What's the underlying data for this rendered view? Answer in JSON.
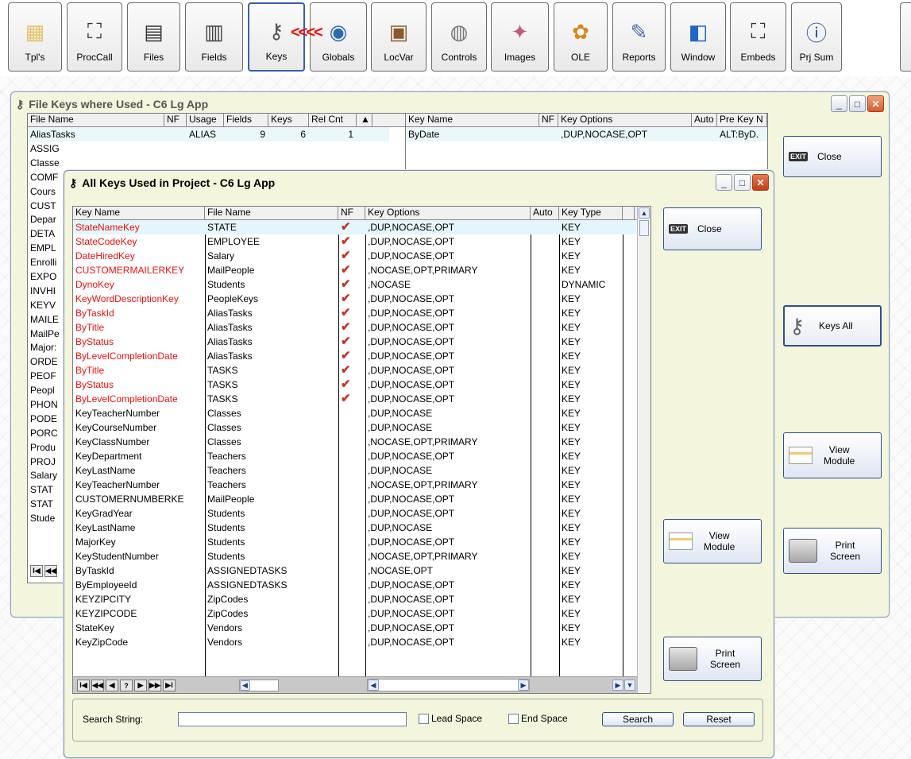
{
  "toolbar": {
    "buttons": [
      {
        "label": "Tpl's"
      },
      {
        "label": "ProcCall"
      },
      {
        "label": "Files"
      },
      {
        "label": "Fields"
      },
      {
        "label": "Keys"
      },
      {
        "label": "Globals"
      },
      {
        "label": "LocVar"
      },
      {
        "label": "Controls"
      },
      {
        "label": "Images"
      },
      {
        "label": "OLE"
      },
      {
        "label": "Reports"
      },
      {
        "label": "Window"
      },
      {
        "label": "Embeds"
      },
      {
        "label": "Prj Sum"
      }
    ],
    "red_arrows": "<<<<"
  },
  "file_keys_window": {
    "title": "File Keys where Used  -  C6 Lg App",
    "files_columns": [
      "File Name",
      "NF",
      "Usage",
      "Fields",
      "Keys",
      "Rel Cnt"
    ],
    "files_first_row": {
      "name": "AliasTasks",
      "usage": "ALIAS",
      "fields": "9",
      "keys": "6",
      "relcnt": "1"
    },
    "files_names": [
      "ASSIG",
      "Classe",
      "COMF",
      "Cours",
      "CUST",
      "Depar",
      "DETA",
      "EMPL",
      "Enrolli",
      "EXPO",
      "INVHI",
      "KEYV",
      "MAILE",
      "MailPe",
      "Major:",
      "ORDE",
      "PEOF",
      "Peopl",
      "PHON",
      "PODE",
      "PORC",
      "Produ",
      "PROJ",
      "Salary",
      "STAT",
      "STAT",
      "Stude"
    ],
    "keys_columns": [
      "Key Name",
      "NF",
      "Key Options",
      "Auto",
      "Pre Key N"
    ],
    "keys_first_row": {
      "name": "ByDate",
      "options": ",DUP,NOCASE,OPT",
      "prekey": "ALT:ByD."
    },
    "close_label": "Close",
    "keys_all_label": "Keys All",
    "keys_all_arrows": ">>>",
    "view_module_label": [
      "View",
      "Module"
    ],
    "print_screen_label": [
      "Print",
      "Screen"
    ],
    "exit_badge": "EXIT"
  },
  "all_keys_window": {
    "title": "All Keys Used in Project  -  C6 Lg App",
    "columns": [
      "Key Name",
      "File Name",
      "NF",
      "Key Options",
      "Auto",
      "Key Type"
    ],
    "rows": [
      {
        "key": "StateNameKey",
        "file": "STATE",
        "nf": true,
        "options": ",DUP,NOCASE,OPT",
        "type": "KEY",
        "red": true
      },
      {
        "key": "StateCodeKey",
        "file": "EMPLOYEE",
        "nf": true,
        "options": ",DUP,NOCASE,OPT",
        "type": "KEY",
        "red": true
      },
      {
        "key": "DateHiredKey",
        "file": "Salary",
        "nf": true,
        "options": ",DUP,NOCASE,OPT",
        "type": "KEY",
        "red": true
      },
      {
        "key": "CUSTOMERMAILERKEY",
        "file": "MailPeople",
        "nf": true,
        "options": ",NOCASE,OPT,PRIMARY",
        "type": "KEY",
        "red": true
      },
      {
        "key": "DynoKey",
        "file": "Students",
        "nf": true,
        "options": ",NOCASE",
        "type": "DYNAMIC",
        "red": true
      },
      {
        "key": "KeyWordDescriptionKey",
        "file": "PeopleKeys",
        "nf": true,
        "options": ",DUP,NOCASE,OPT",
        "type": "KEY",
        "red": true
      },
      {
        "key": "ByTaskId",
        "file": "AliasTasks",
        "nf": true,
        "options": ",DUP,NOCASE,OPT",
        "type": "KEY",
        "red": true
      },
      {
        "key": "ByTitle",
        "file": "AliasTasks",
        "nf": true,
        "options": ",DUP,NOCASE,OPT",
        "type": "KEY",
        "red": true
      },
      {
        "key": "ByStatus",
        "file": "AliasTasks",
        "nf": true,
        "options": ",DUP,NOCASE,OPT",
        "type": "KEY",
        "red": true
      },
      {
        "key": "ByLevelCompletionDate",
        "file": "AliasTasks",
        "nf": true,
        "options": ",DUP,NOCASE,OPT",
        "type": "KEY",
        "red": true
      },
      {
        "key": "ByTitle",
        "file": "TASKS",
        "nf": true,
        "options": ",DUP,NOCASE,OPT",
        "type": "KEY",
        "red": true
      },
      {
        "key": "ByStatus",
        "file": "TASKS",
        "nf": true,
        "options": ",DUP,NOCASE,OPT",
        "type": "KEY",
        "red": true
      },
      {
        "key": "ByLevelCompletionDate",
        "file": "TASKS",
        "nf": true,
        "options": ",DUP,NOCASE,OPT",
        "type": "KEY",
        "red": true
      },
      {
        "key": "KeyTeacherNumber",
        "file": "Classes",
        "nf": false,
        "options": ",DUP,NOCASE",
        "type": "KEY",
        "red": false
      },
      {
        "key": "KeyCourseNumber",
        "file": "Classes",
        "nf": false,
        "options": ",DUP,NOCASE",
        "type": "KEY",
        "red": false
      },
      {
        "key": "KeyClassNumber",
        "file": "Classes",
        "nf": false,
        "options": ",NOCASE,OPT,PRIMARY",
        "type": "KEY",
        "red": false
      },
      {
        "key": "KeyDepartment",
        "file": "Teachers",
        "nf": false,
        "options": ",DUP,NOCASE,OPT",
        "type": "KEY",
        "red": false
      },
      {
        "key": "KeyLastName",
        "file": "Teachers",
        "nf": false,
        "options": ",DUP,NOCASE",
        "type": "KEY",
        "red": false
      },
      {
        "key": "KeyTeacherNumber",
        "file": "Teachers",
        "nf": false,
        "options": ",NOCASE,OPT,PRIMARY",
        "type": "KEY",
        "red": false
      },
      {
        "key": "CUSTOMERNUMBERKE",
        "file": "MailPeople",
        "nf": false,
        "options": ",DUP,NOCASE,OPT",
        "type": "KEY",
        "red": false
      },
      {
        "key": "KeyGradYear",
        "file": "Students",
        "nf": false,
        "options": ",DUP,NOCASE,OPT",
        "type": "KEY",
        "red": false
      },
      {
        "key": "KeyLastName",
        "file": "Students",
        "nf": false,
        "options": ",DUP,NOCASE",
        "type": "KEY",
        "red": false
      },
      {
        "key": "MajorKey",
        "file": "Students",
        "nf": false,
        "options": ",DUP,NOCASE,OPT",
        "type": "KEY",
        "red": false
      },
      {
        "key": "KeyStudentNumber",
        "file": "Students",
        "nf": false,
        "options": ",NOCASE,OPT,PRIMARY",
        "type": "KEY",
        "red": false
      },
      {
        "key": "ByTaskId",
        "file": "ASSIGNEDTASKS",
        "nf": false,
        "options": ",NOCASE,OPT",
        "type": "KEY",
        "red": false
      },
      {
        "key": "ByEmployeeId",
        "file": "ASSIGNEDTASKS",
        "nf": false,
        "options": ",DUP,NOCASE,OPT",
        "type": "KEY",
        "red": false
      },
      {
        "key": "KEYZIPCITY",
        "file": "ZipCodes",
        "nf": false,
        "options": ",DUP,NOCASE,OPT",
        "type": "KEY",
        "red": false
      },
      {
        "key": "KEYZIPCODE",
        "file": "ZipCodes",
        "nf": false,
        "options": ",DUP,NOCASE,OPT",
        "type": "KEY",
        "red": false
      },
      {
        "key": "StateKey",
        "file": "Vendors",
        "nf": false,
        "options": ",DUP,NOCASE,OPT",
        "type": "KEY",
        "red": false
      },
      {
        "key": "KeyZipCode",
        "file": "Vendors",
        "nf": false,
        "options": ",DUP,NOCASE,OPT",
        "type": "KEY",
        "red": false
      }
    ],
    "close_label": "Close",
    "view_module_label": [
      "View",
      "Module"
    ],
    "print_screen_label": [
      "Print",
      "Screen"
    ],
    "exit_badge": "EXIT",
    "nav_buttons": [
      "I◀",
      "◀◀",
      "◀",
      "?",
      "▶",
      "▶▶",
      "▶I"
    ],
    "search": {
      "label": "Search String:",
      "value": "",
      "lead_space": "Lead Space",
      "end_space": "End Space",
      "search_btn": "Search",
      "reset_btn": "Reset"
    }
  },
  "colors": {
    "red_text": "#ee1111",
    "check_red": "#c0352b",
    "window_bg": "#f3f5dc",
    "border_blue": "#2f4f8f"
  }
}
